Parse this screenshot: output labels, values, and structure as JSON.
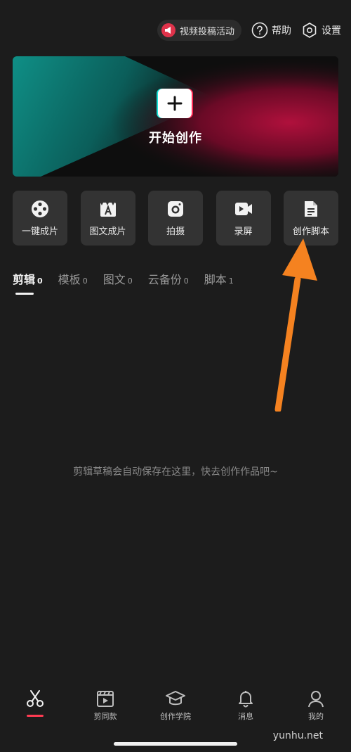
{
  "header": {
    "promo_label": "视频投稿活动",
    "help_label": "帮助",
    "settings_label": "设置"
  },
  "banner": {
    "label": "开始创作"
  },
  "tiles": [
    {
      "label": "一键成片",
      "icon": "film-reel-icon"
    },
    {
      "label": "图文成片",
      "icon": "text-clip-icon"
    },
    {
      "label": "拍摄",
      "icon": "camera-icon"
    },
    {
      "label": "录屏",
      "icon": "video-record-icon"
    },
    {
      "label": "创作脚本",
      "icon": "script-doc-icon"
    }
  ],
  "tabs": [
    {
      "label": "剪辑",
      "count": "0"
    },
    {
      "label": "模板",
      "count": "0"
    },
    {
      "label": "图文",
      "count": "0"
    },
    {
      "label": "云备份",
      "count": "0"
    },
    {
      "label": "脚本",
      "count": "1"
    }
  ],
  "empty_hint": "剪辑草稿会自动保存在这里，快去创作作品吧~",
  "bottom_nav": [
    {
      "label": "",
      "icon": "scissors-icon"
    },
    {
      "label": "剪同款",
      "icon": "template-clip-icon"
    },
    {
      "label": "创作学院",
      "icon": "graduation-cap-icon"
    },
    {
      "label": "消息",
      "icon": "bell-icon"
    },
    {
      "label": "我的",
      "icon": "person-icon"
    }
  ],
  "watermark": "yunhu.net",
  "colors": {
    "background": "#1c1c1c",
    "accent": "#ff3b52",
    "arrow": "#f58220"
  }
}
